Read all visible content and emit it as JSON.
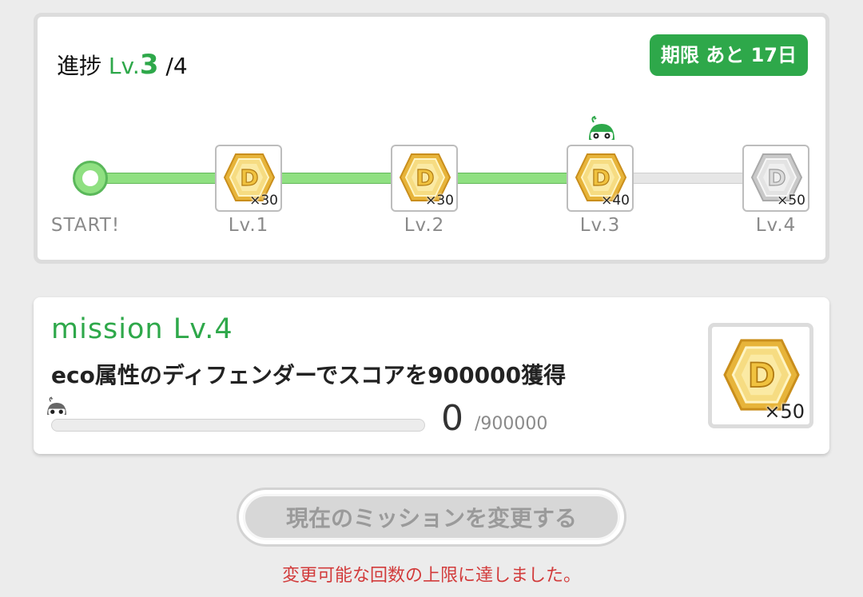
{
  "progress": {
    "title_prefix": "進捗",
    "current_level_prefix": "Lv.",
    "current_level": "3",
    "max_level": "/4",
    "deadline_badge": "期限 あと 17日",
    "start_label": "START!",
    "steps": [
      {
        "label": "Lv.1",
        "reward_qty": "×30",
        "unlocked": true
      },
      {
        "label": "Lv.2",
        "reward_qty": "×30",
        "unlocked": true
      },
      {
        "label": "Lv.3",
        "reward_qty": "×40",
        "unlocked": true
      },
      {
        "label": "Lv.4",
        "reward_qty": "×50",
        "unlocked": false
      }
    ]
  },
  "mission": {
    "title": "mission Lv.4",
    "description": "eco属性のディフェンダーでスコアを900000獲得",
    "current_value": "0",
    "target_value": "/900000",
    "progress_fraction": 0,
    "reward_qty": "×50"
  },
  "actions": {
    "change_mission_label": "現在のミッションを変更する",
    "change_mission_enabled": false,
    "limit_notice": "変更可能な回数の上限に達しました。"
  },
  "colors": {
    "accent_green": "#2ea84a",
    "track_green": "#8fe081",
    "notice_red": "#d23b3b"
  },
  "icons": {
    "reward": "d-medal-icon",
    "current_marker": "character-marker-icon"
  }
}
